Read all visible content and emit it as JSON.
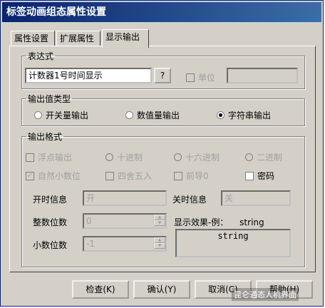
{
  "window": {
    "title": "标签动画组态属性设置"
  },
  "tabs": [
    {
      "label": "属性设置"
    },
    {
      "label": "扩展属性"
    },
    {
      "label": "显示输出"
    }
  ],
  "expression": {
    "group_label": "表达式",
    "value": "计数器1号时间显示",
    "browse_label": "?",
    "unit_label": "单位",
    "unit_value": ""
  },
  "output_type": {
    "group_label": "输出值类型",
    "options": [
      {
        "label": "开关量输出",
        "selected": false
      },
      {
        "label": "数值量输出",
        "selected": false
      },
      {
        "label": "字符串输出",
        "selected": true
      }
    ]
  },
  "output_format": {
    "group_label": "输出格式",
    "row1": [
      {
        "kind": "check",
        "label": "浮点输出",
        "checked": false
      },
      {
        "kind": "radio",
        "label": "十进制",
        "selected": false
      },
      {
        "kind": "radio",
        "label": "十六进制",
        "selected": false
      },
      {
        "kind": "radio",
        "label": "二进制",
        "selected": false
      }
    ],
    "row2": [
      {
        "kind": "check",
        "label": "自然小数位",
        "checked": true
      },
      {
        "kind": "check",
        "label": "四舍五入",
        "checked": false
      },
      {
        "kind": "check",
        "label": "前导0",
        "checked": false
      },
      {
        "kind": "check",
        "label": "密码",
        "checked": false
      }
    ],
    "on_label": "开时信息",
    "on_value": "开",
    "off_label": "关时信息",
    "off_value": "关",
    "int_digits_label": "整数位数",
    "int_digits_value": "0",
    "dec_digits_label": "小数位数",
    "dec_digits_value": "-1",
    "preview_label": "显示效果-例：",
    "preview_example": "string",
    "preview_value": "string"
  },
  "buttons": {
    "check": "检查(K)",
    "ok": "确认(Y)",
    "cancel": "取消(C)",
    "help": "帮助(H)"
  },
  "watermark": "昆仑通态人机界面"
}
